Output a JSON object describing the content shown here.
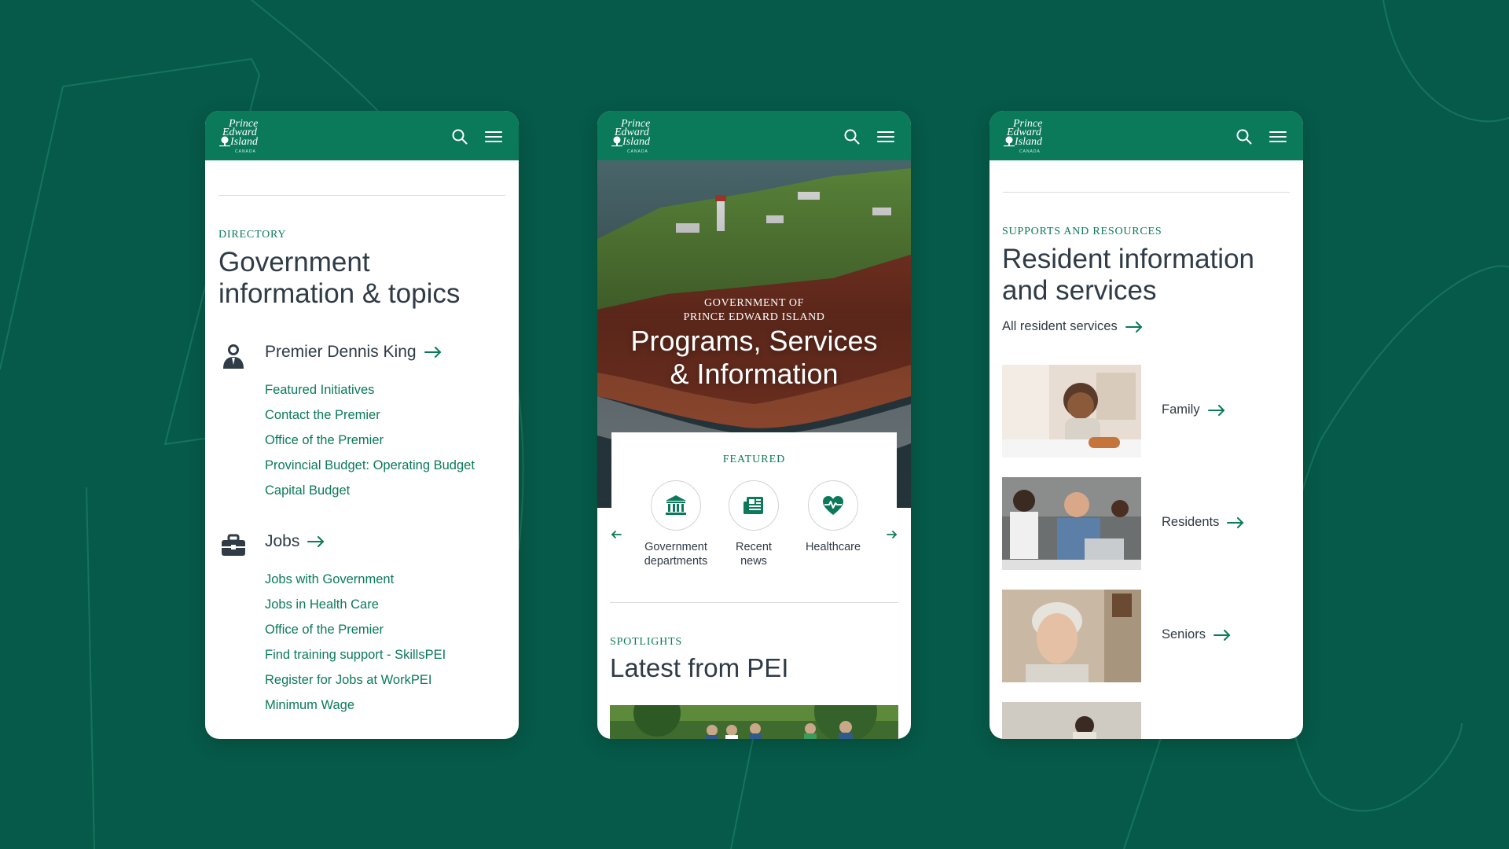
{
  "brand": {
    "logo_line1": "Prince",
    "logo_line2": "Edward",
    "logo_line3": "Island",
    "logo_country": "CANADA",
    "primary_color": "#0b7a5a",
    "background_color": "#065a49",
    "text_color": "#2f3b46"
  },
  "header_icons": [
    "search-icon",
    "menu-icon"
  ],
  "directory": {
    "eyebrow": "DIRECTORY",
    "title": "Government information & topics",
    "premier": {
      "heading": "Premier Dennis King",
      "links": [
        "Featured Initiatives",
        "Contact the Premier",
        "Office of the Premier",
        "Provincial Budget: Operating Budget",
        "Capital Budget"
      ]
    },
    "jobs": {
      "heading": "Jobs",
      "links": [
        "Jobs with Government",
        "Jobs in Health Care",
        "Office of the Premier",
        "Find training support - SkillsPEI",
        "Register for Jobs at WorkPEI",
        "Minimum Wage"
      ]
    }
  },
  "home": {
    "hero_sub_line1": "GOVERNMENT OF",
    "hero_sub_line2": "PRINCE EDWARD ISLAND",
    "hero_title_line1": "Programs, Services",
    "hero_title_line2": "& Information",
    "featured_label": "FEATURED",
    "featured_items": [
      {
        "icon": "bank-icon",
        "line1": "Government",
        "line2": "departments"
      },
      {
        "icon": "news-icon",
        "line1": "Recent",
        "line2": "news"
      },
      {
        "icon": "heart-pulse-icon",
        "line1": "Healthcare",
        "line2": ""
      }
    ],
    "spotlights_label": "SPOTLIGHTS",
    "latest_title": "Latest from PEI"
  },
  "residents": {
    "eyebrow": "SUPPORTS AND RESOURCES",
    "title_line1": "Resident information",
    "title_line2": "and services",
    "all_link": "All resident services",
    "items": [
      {
        "label": "Family"
      },
      {
        "label": "Residents"
      },
      {
        "label": "Seniors"
      }
    ]
  }
}
